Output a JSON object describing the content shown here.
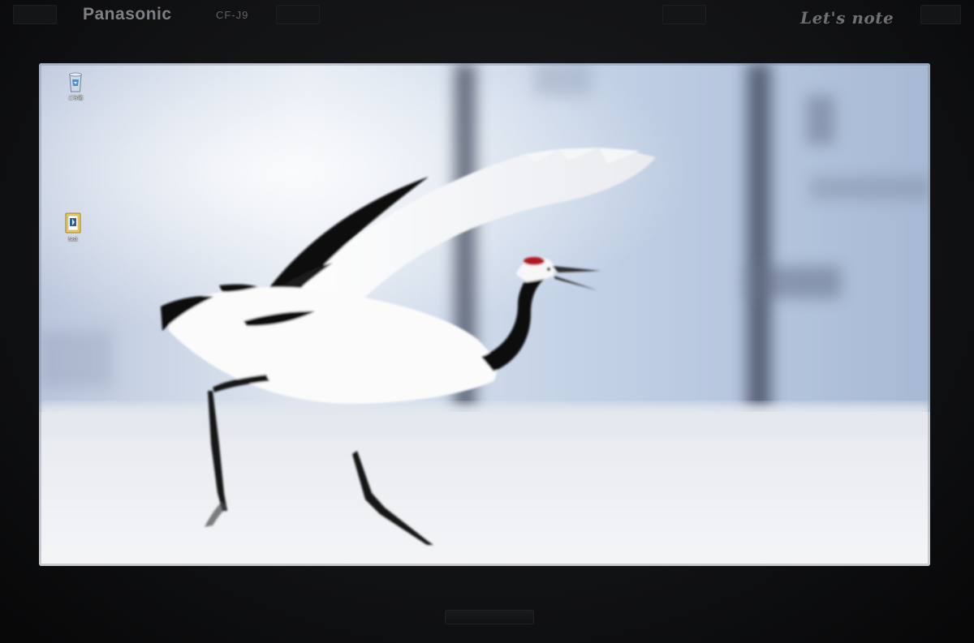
{
  "bezel": {
    "brand": "Panasonic",
    "model": "CF-J9",
    "series": "Let's note"
  },
  "desktop": {
    "icons": [
      {
        "label": "ごみ箱",
        "icon": "recycle-bin-icon"
      },
      {
        "label": "test",
        "icon": "folder-document-icon"
      }
    ]
  },
  "colors": {
    "bezel": "#111214",
    "sky": "#a9bdd8",
    "snow": "#f1f2f4",
    "crane_black": "#0b0b0d",
    "crane_crown": "#b3141f"
  }
}
